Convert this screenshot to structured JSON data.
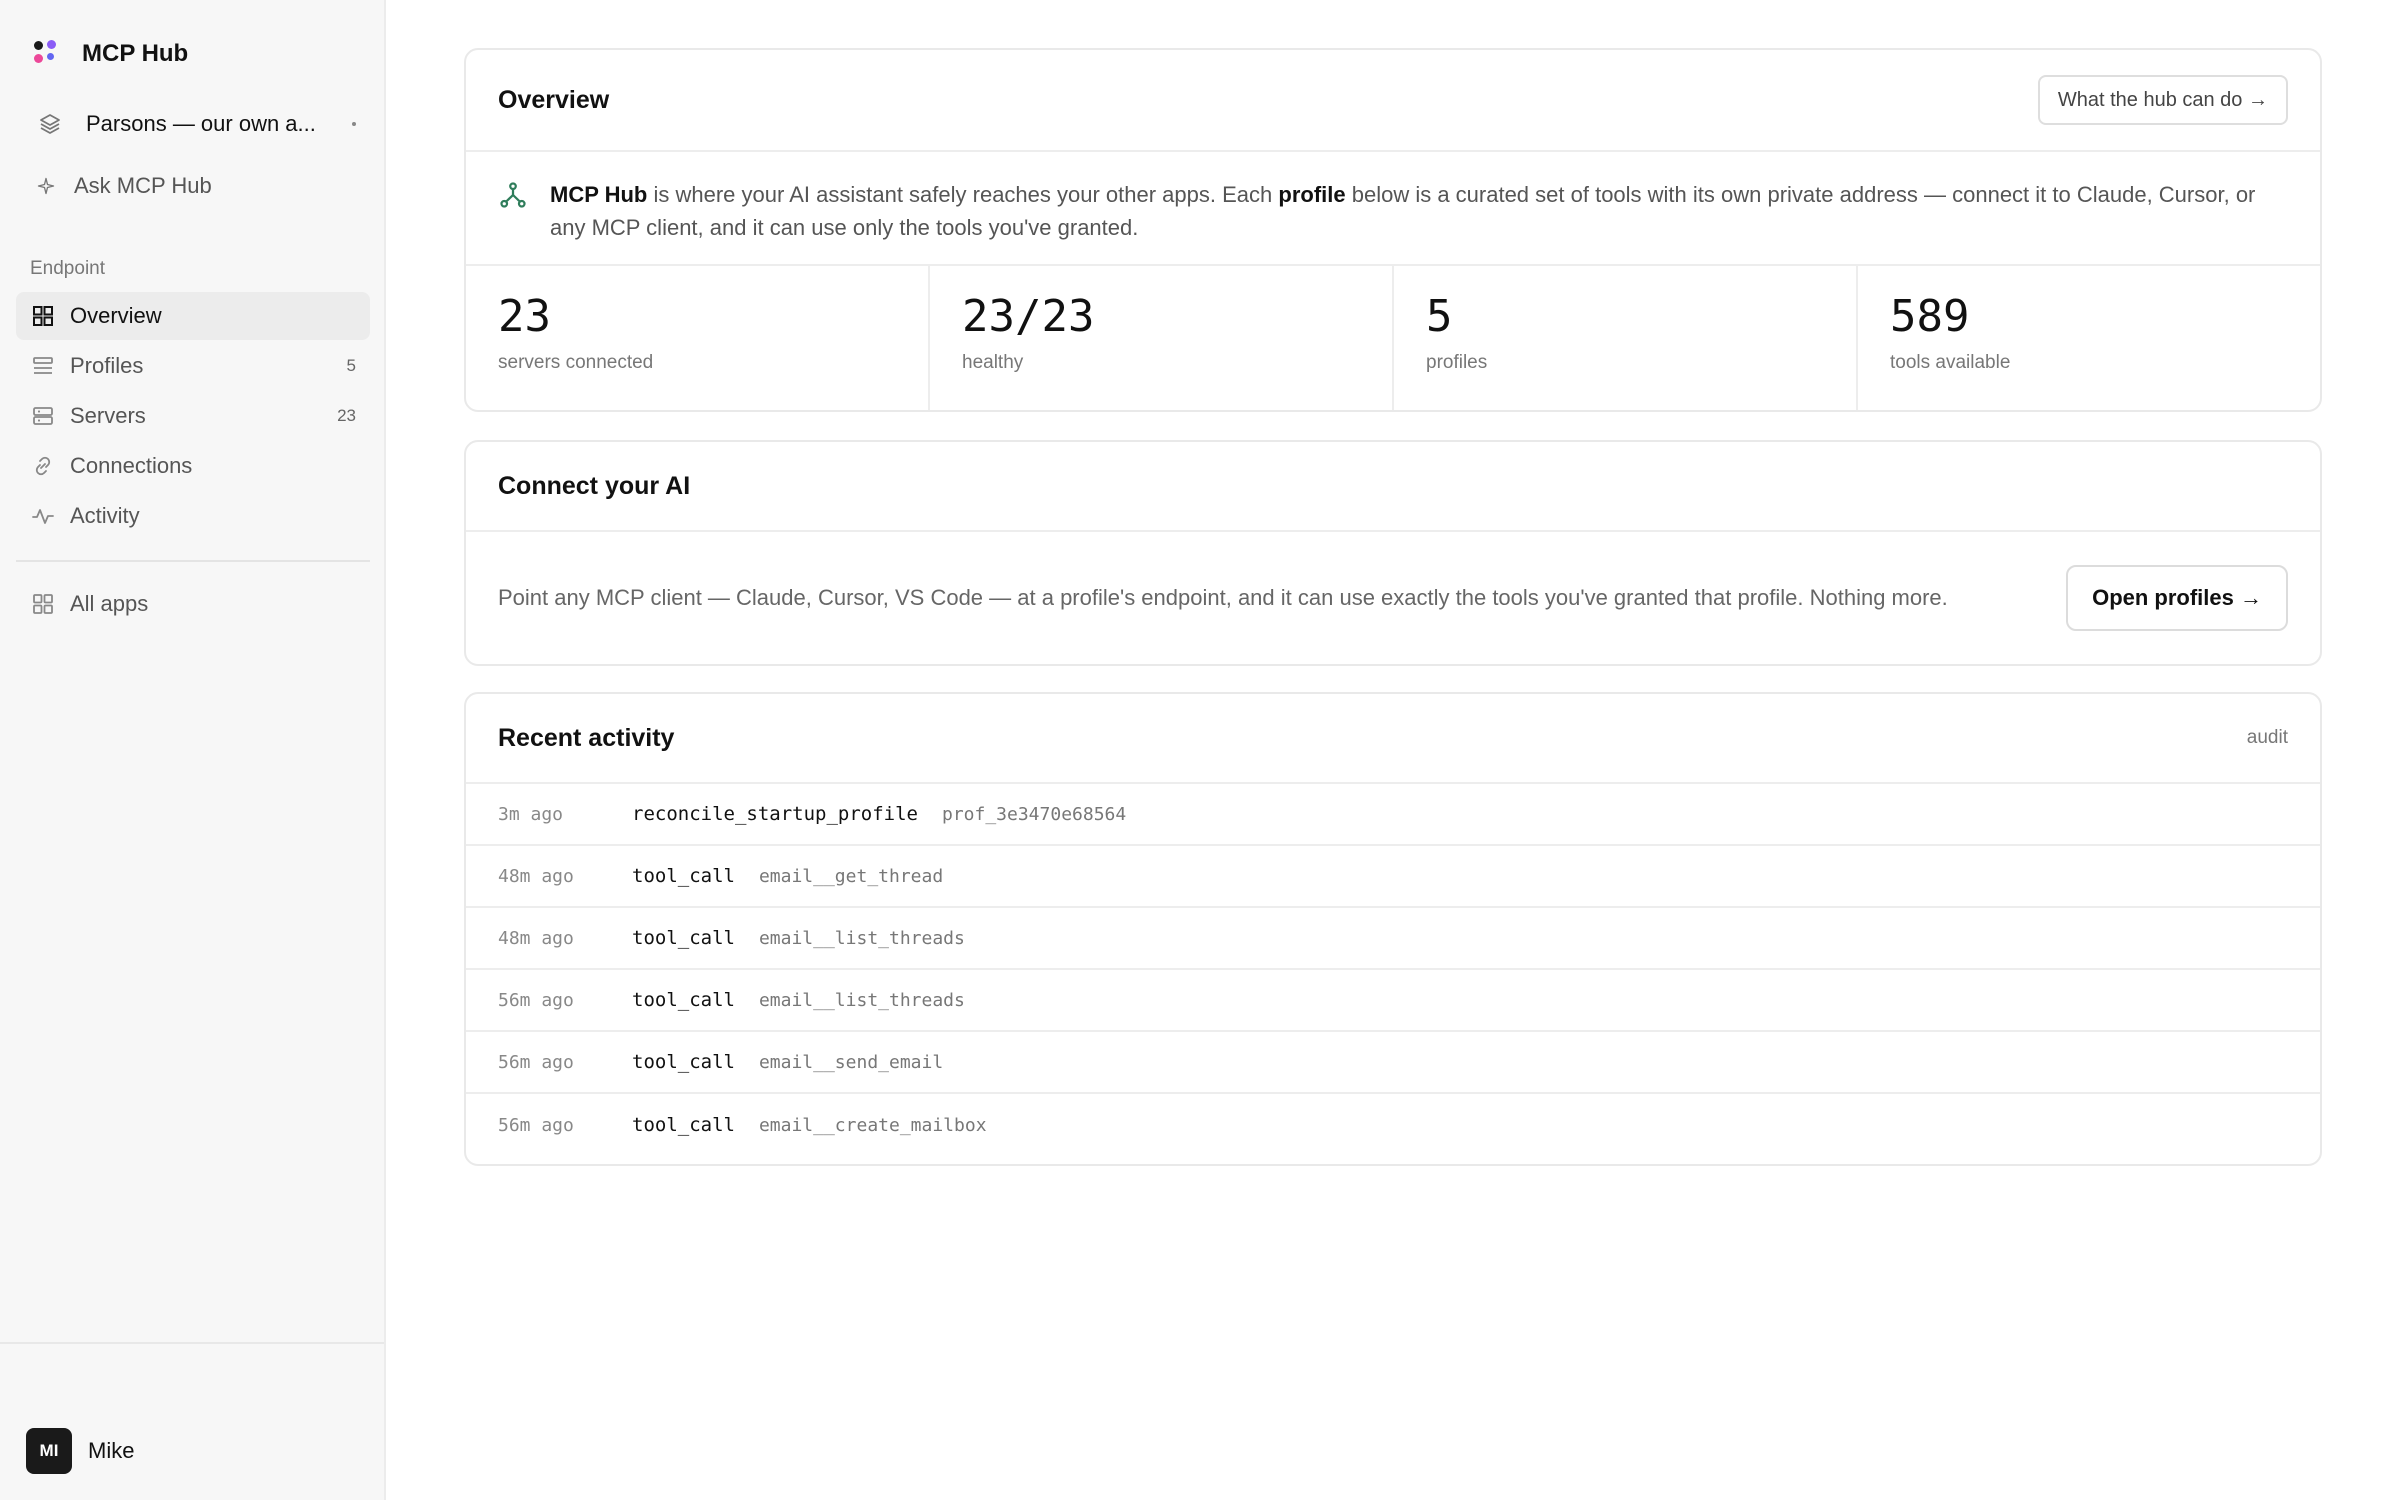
{
  "brand": {
    "name": "MCP Hub",
    "logo_colors": [
      "#1a1a1a",
      "#8b5cf6",
      "#ec4899",
      "#6366f1"
    ]
  },
  "workspace": {
    "name": "Parsons — our own a..."
  },
  "ask": {
    "label": "Ask MCP Hub"
  },
  "sidebar": {
    "section_label": "Endpoint",
    "items": [
      {
        "label": "Overview",
        "icon": "grid-icon",
        "count": "",
        "active": true
      },
      {
        "label": "Profiles",
        "icon": "layers-list-icon",
        "count": "5"
      },
      {
        "label": "Servers",
        "icon": "server-icon",
        "count": "23"
      },
      {
        "label": "Connections",
        "icon": "link-icon",
        "count": ""
      },
      {
        "label": "Activity",
        "icon": "activity-pulse-icon",
        "count": ""
      }
    ],
    "bottom_item": {
      "label": "All apps",
      "icon": "apps-grid-icon"
    }
  },
  "user": {
    "initials": "MI",
    "name": "Mike"
  },
  "overview": {
    "title": "Overview",
    "button": "What the hub can do →",
    "intro": {
      "brand": "MCP Hub",
      "part1": " is where your AI assistant safely reaches your other apps. Each ",
      "profile_word": "profile",
      "part2": " below is a curated set of tools with its own private address — connect it to Claude, Cursor, or any MCP client, and it can use only the tools you've granted."
    },
    "stats": [
      {
        "value": "23",
        "label": "servers connected"
      },
      {
        "value": "23/23",
        "label": "healthy"
      },
      {
        "value": "5",
        "label": "profiles"
      },
      {
        "value": "589",
        "label": "tools available"
      }
    ]
  },
  "connect": {
    "title": "Connect your AI",
    "text": "Point any MCP client — Claude, Cursor, VS Code — at a profile's endpoint, and it can use exactly the tools you've granted that profile. Nothing more.",
    "button": "Open profiles →"
  },
  "activity": {
    "title": "Recent activity",
    "link": "audit",
    "rows": [
      {
        "time": "3m ago",
        "action": "reconcile_startup_profile",
        "target": "prof_3e3470e68564"
      },
      {
        "time": "48m ago",
        "action": "tool_call",
        "target": "email__get_thread"
      },
      {
        "time": "48m ago",
        "action": "tool_call",
        "target": "email__list_threads"
      },
      {
        "time": "56m ago",
        "action": "tool_call",
        "target": "email__list_threads"
      },
      {
        "time": "56m ago",
        "action": "tool_call",
        "target": "email__send_email"
      },
      {
        "time": "56m ago",
        "action": "tool_call",
        "target": "email__create_mailbox"
      }
    ]
  },
  "colors": {
    "accent_green": "#2f7d5b",
    "active_bg": "#ececec",
    "sidebar_bg": "#f7f7f7"
  }
}
